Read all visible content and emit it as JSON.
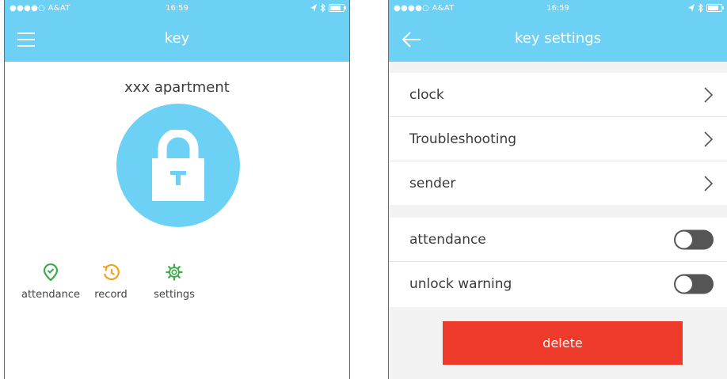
{
  "left_screen": {
    "status_bar": {
      "carrier": "●●●●○ A&AT",
      "time": "16:59"
    },
    "title": "key",
    "apartment_name": "xxx apartment",
    "actions": [
      {
        "label": "attendance",
        "icon": "location-check-icon",
        "color": "#3cab4b"
      },
      {
        "label": "record",
        "icon": "history-clock-icon",
        "color": "#f0a01e"
      },
      {
        "label": "settings",
        "icon": "gear-icon",
        "color": "#3cab4b"
      }
    ]
  },
  "right_screen": {
    "status_bar": {
      "carrier": "●●●●○ A&AT",
      "time": "16:59"
    },
    "title": "key settings",
    "nav_rows": [
      {
        "label": "clock"
      },
      {
        "label": "Troubleshooting"
      },
      {
        "label": "sender"
      }
    ],
    "toggle_rows": [
      {
        "label": "attendance",
        "enabled": false
      },
      {
        "label": "unlock warning",
        "enabled": false
      }
    ],
    "delete_label": "delete"
  },
  "colors": {
    "header": "#6dd0f5",
    "delete": "#ee3a2a",
    "toggle_off": "#555555"
  }
}
